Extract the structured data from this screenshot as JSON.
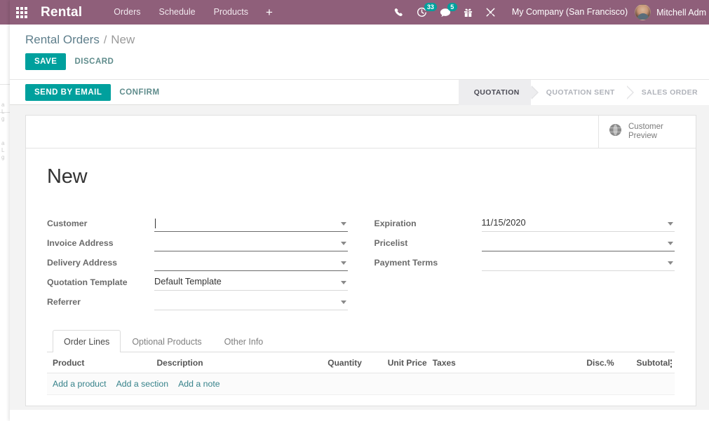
{
  "navbar": {
    "apps_icon": "grid-apps-icon",
    "brand": "Rental",
    "menu_items": [
      {
        "label": "Orders"
      },
      {
        "label": "Schedule"
      },
      {
        "label": "Products"
      }
    ],
    "add_menu_label": "+",
    "icons": [
      {
        "name": "phone-icon",
        "badge": null
      },
      {
        "name": "activity-clock-icon",
        "badge": "33"
      },
      {
        "name": "messages-icon",
        "badge": "5"
      },
      {
        "name": "gift-icon",
        "badge": null
      },
      {
        "name": "tools-icon",
        "badge": null
      }
    ],
    "company": "My Company (San Francisco)",
    "user": "Mitchell Adm",
    "bg_color": "#8f5f7a"
  },
  "breadcrumb": {
    "parent": "Rental Orders",
    "separator": "/",
    "current": "New"
  },
  "controls": {
    "save_label": "SAVE",
    "discard_label": "DISCARD"
  },
  "statusbar_actions": {
    "send_by_email": "SEND BY EMAIL",
    "confirm": "CONFIRM"
  },
  "statusbar": {
    "stages": [
      {
        "label": "QUOTATION",
        "active": true
      },
      {
        "label": "QUOTATION SENT",
        "active": false
      },
      {
        "label": "SALES ORDER",
        "active": false
      }
    ]
  },
  "stat_buttons": {
    "customer_preview": {
      "icon": "globe-icon",
      "line1": "Customer",
      "line2": "Preview"
    }
  },
  "record": {
    "title": "New"
  },
  "form": {
    "left_fields": [
      {
        "label": "Customer",
        "value": "",
        "placeholder": "",
        "required": true,
        "focused": true
      },
      {
        "label": "Invoice Address",
        "value": "",
        "placeholder": "",
        "required": true,
        "focused": false
      },
      {
        "label": "Delivery Address",
        "value": "",
        "placeholder": "",
        "required": true,
        "focused": false
      },
      {
        "label": "Quotation Template",
        "value": "Default Template",
        "placeholder": "",
        "required": false,
        "focused": false
      },
      {
        "label": "Referrer",
        "value": "",
        "placeholder": "",
        "required": false,
        "focused": false
      }
    ],
    "right_fields": [
      {
        "label": "Expiration",
        "value": "11/15/2020",
        "placeholder": "",
        "required": false,
        "focused": false
      },
      {
        "label": "Pricelist",
        "value": "",
        "placeholder": "",
        "required": true,
        "focused": false
      },
      {
        "label": "Payment Terms",
        "value": "",
        "placeholder": "",
        "required": false,
        "focused": false
      }
    ]
  },
  "notebook": {
    "tabs": [
      {
        "label": "Order Lines",
        "active": true
      },
      {
        "label": "Optional Products",
        "active": false
      },
      {
        "label": "Other Info",
        "active": false
      }
    ]
  },
  "order_lines": {
    "columns": [
      "Product",
      "Description",
      "Quantity",
      "Unit Price",
      "Taxes",
      "Disc.%",
      "Subtotal"
    ],
    "optional_columns_icon": "vertical-dots-icon",
    "rows": [],
    "add_links": [
      {
        "label": "Add a product"
      },
      {
        "label": "Add a section"
      },
      {
        "label": "Add a note"
      }
    ]
  },
  "theme": {
    "primary": "#00a09d",
    "navbar": "#8f5f7a",
    "link": "#36828a",
    "badge": "#00a09d"
  }
}
